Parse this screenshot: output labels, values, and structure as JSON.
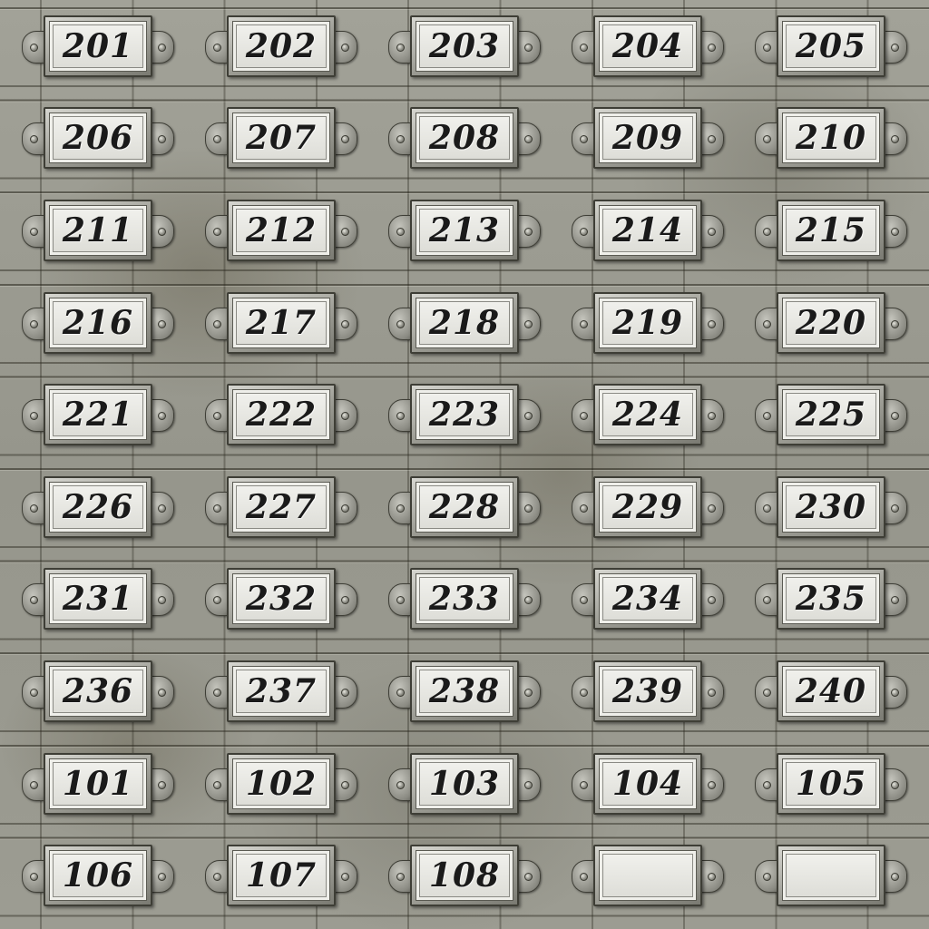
{
  "labels": [
    "201",
    "202",
    "203",
    "204",
    "205",
    "206",
    "207",
    "208",
    "209",
    "210",
    "211",
    "212",
    "213",
    "214",
    "215",
    "216",
    "217",
    "218",
    "219",
    "220",
    "221",
    "222",
    "223",
    "224",
    "225",
    "226",
    "227",
    "228",
    "229",
    "230",
    "231",
    "232",
    "233",
    "234",
    "235",
    "236",
    "237",
    "238",
    "239",
    "240",
    "101",
    "102",
    "103",
    "104",
    "105",
    "106",
    "107",
    "108",
    "",
    ""
  ]
}
